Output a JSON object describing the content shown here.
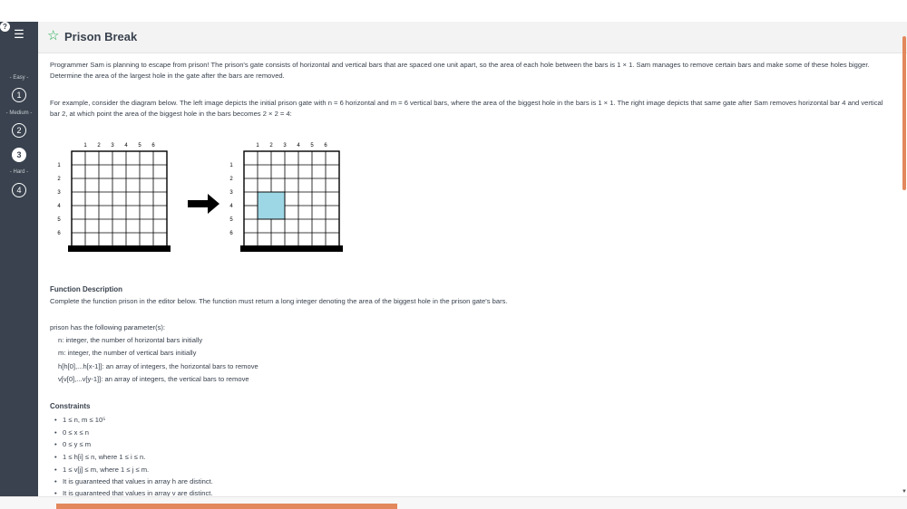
{
  "header": {
    "title": "Prison Break"
  },
  "sidebar": {
    "labels": {
      "easy": "- Easy -",
      "medium": "- Medium -",
      "hard": "- Hard -"
    },
    "questions": [
      "1",
      "2",
      "3",
      "4"
    ]
  },
  "content": {
    "p1": "Programmer Sam is planning to escape from prison! The prison's gate consists of horizontal and vertical bars that are spaced one unit apart, so the area of each hole between the bars is 1 × 1. Sam manages to remove certain bars and make some of these holes bigger. Determine the area of the largest hole in the gate after the bars are removed.",
    "p2": "For example, consider the diagram below. The left image depicts the initial prison gate with n = 6 horizontal and m = 6 vertical bars, where the area of the biggest hole in the bars is 1 × 1. The right image depicts that same gate after Sam removes horizontal bar 4 and vertical bar 2, at which point the area of the biggest hole in the bars becomes 2 × 2 = 4:",
    "diagram": {
      "col_labels": [
        "1",
        "2",
        "3",
        "4",
        "5",
        "6"
      ],
      "row_labels": [
        "1",
        "2",
        "3",
        "4",
        "5",
        "6"
      ]
    },
    "function_heading": "Function Description",
    "function_text": "Complete the function prison in the editor below. The function must return a long integer denoting the area of the biggest hole in the prison gate's bars.",
    "params_intro": "prison has the following parameter(s):",
    "params": [
      "n:  integer, the number of horizontal bars initially",
      "m:  integer, the number of vertical bars initially",
      "h[h[0],...h[x-1]]:  an array of integers, the horizontal bars to remove",
      "v[v[0],...v[y-1]]:  an array of integers, the vertical bars to remove"
    ],
    "constraints_heading": "Constraints",
    "constraints": [
      "1 ≤ n, m ≤ 10⁵",
      "0 ≤ x ≤ n",
      "0 ≤ y ≤ m",
      "1 ≤ h[i] ≤ n, where 1 ≤ i ≤ n.",
      "1 ≤ v[j] ≤ m, where 1 ≤ j ≤ m.",
      "It is guaranteed that values in array h are distinct.",
      "It is guaranteed that values in array v are distinct."
    ]
  }
}
